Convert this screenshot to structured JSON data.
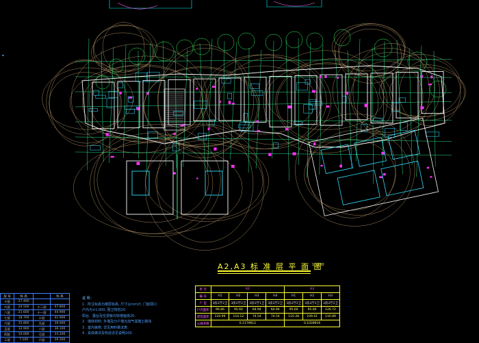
{
  "drawing": {
    "title": "A2,A3 标 准 层 平 面 图",
    "scale": "1 : 100"
  },
  "notes": {
    "heading": "说 明 :",
    "lines": [
      "1 . 所注标高为楼层标高, 尺寸以mm计, 门窗洞口",
      "   户内为±1.000, 厨卫较低20.",
      "   阳台、露台及空调板均较楼面低20.",
      "2 . 墙体材料: 外墙及分户墙为加气混凝土砌块.",
      "3 . 室内装修, 详见用料做法表.",
      "4 . 具体做法及构造详见说明100."
    ]
  },
  "area_table": {
    "header": [
      "单 元",
      "A2",
      "A3"
    ],
    "rows": [
      {
        "label": "编 号",
        "cells": [
          "H1",
          "H2",
          "H3",
          "H4",
          "H1",
          "H2",
          "H3"
        ]
      },
      {
        "label": "户 型",
        "cells": [
          "3房2厅2卫",
          "3房2厅2卫",
          "3房2厅1卫",
          "3房2厅2卫",
          "3房2厅2卫",
          "3房2厅2卫",
          "3房2厅2卫"
        ]
      },
      {
        "label": "户内面积",
        "cells": [
          "96.66",
          "95.60",
          "64.94",
          "64.94",
          "95.60",
          "95.60",
          "126.72"
        ]
      },
      {
        "label": "建筑面积",
        "cells": [
          "110.99",
          "110.12",
          "74.54",
          "74.54",
          "110.28",
          "109.41",
          "116.89"
        ]
      },
      {
        "label": "公摊系数",
        "cells": [
          "0.1179612",
          "0.1028916"
        ]
      }
    ]
  },
  "floor_table": {
    "header": [
      "层 号",
      "标 高",
      "",
      "标 高"
    ],
    "rows": [
      [
        "十层",
        "27.400",
        "",
        ""
      ],
      [
        "九层",
        "24.500",
        "十二层",
        "47.800"
      ],
      [
        "八层",
        "21.600",
        "十一层",
        "44.900"
      ],
      [
        "七层",
        "18.700",
        "十层",
        "41.900"
      ],
      [
        "六层",
        "15.800",
        "九层",
        "39.000"
      ],
      [
        "五层",
        "12.900",
        "八层",
        "36.100"
      ],
      [
        "四层",
        "10.000",
        "七层",
        "33.200"
      ],
      [
        "三层",
        "7.100",
        "六层",
        "30.300"
      ]
    ]
  },
  "colors": {
    "background": "#000000",
    "walls": "#ffffff",
    "axis": "#00ff66",
    "circles": "#ffcc88",
    "grid_lines": "#00ffff",
    "text_yellow": "#ffff33",
    "notes_blue": "#4fa0ff",
    "magenta": "#ff33ff"
  }
}
